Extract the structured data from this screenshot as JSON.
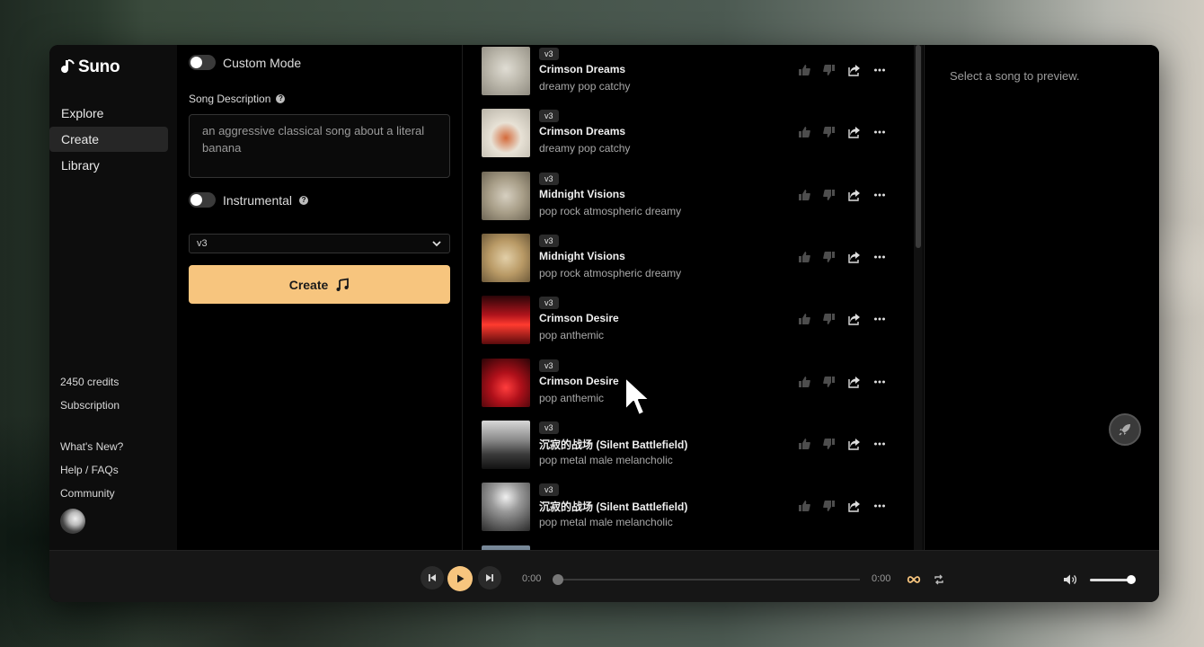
{
  "app": {
    "name": "Suno"
  },
  "sidebar": {
    "items": [
      {
        "label": "Explore",
        "active": false
      },
      {
        "label": "Create",
        "active": true
      },
      {
        "label": "Library",
        "active": false
      }
    ],
    "credits": "2450 credits",
    "subscription": "Subscription",
    "links": [
      "What's New?",
      "Help / FAQs",
      "Community"
    ]
  },
  "create": {
    "custom_mode_label": "Custom Mode",
    "song_description_label": "Song Description",
    "song_description_value": "an aggressive classical song about a literal banana",
    "instrumental_label": "Instrumental",
    "model_selected": "v3",
    "create_label": "Create"
  },
  "songs": [
    {
      "badge": "v3",
      "title": "Crimson Dreams",
      "tags": "dreamy pop catchy",
      "thumb": "bird-sketch"
    },
    {
      "badge": "v3",
      "title": "Crimson Dreams",
      "tags": "dreamy pop catchy",
      "thumb": "bird-guitar-orange"
    },
    {
      "badge": "v3",
      "title": "Midnight Visions",
      "tags": "pop rock atmospheric dreamy",
      "thumb": "bird-guitar"
    },
    {
      "badge": "v3",
      "title": "Midnight Visions",
      "tags": "pop rock atmospheric dreamy",
      "thumb": "bird-guitar-sepia"
    },
    {
      "badge": "v3",
      "title": "Crimson Desire",
      "tags": "pop anthemic",
      "thumb": "red-city"
    },
    {
      "badge": "v3",
      "title": "Crimson Desire",
      "tags": "pop anthemic",
      "thumb": "red-city-2"
    },
    {
      "badge": "v3",
      "title": "沉寂的战场 (Silent Battlefield)",
      "tags": "pop metal male melancholic",
      "thumb": "gray-sea"
    },
    {
      "badge": "v3",
      "title": "沉寂的战场 (Silent Battlefield)",
      "tags": "pop metal male melancholic",
      "thumb": "gray-storm"
    }
  ],
  "preview": {
    "placeholder": "Select a song to preview."
  },
  "player": {
    "current_time": "0:00",
    "duration": "0:00",
    "progress": 0,
    "volume": 0.85
  },
  "colors": {
    "accent": "#f7c57e",
    "background": "#000000"
  }
}
